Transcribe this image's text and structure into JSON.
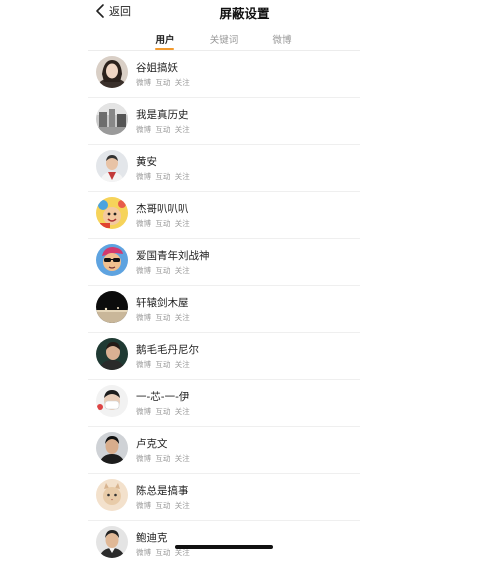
{
  "navbar": {
    "back_label": "返回",
    "title": "屏蔽设置"
  },
  "tabs": [
    {
      "label": "用户",
      "active": true
    },
    {
      "label": "关键词",
      "active": false
    },
    {
      "label": "微博",
      "active": false
    }
  ],
  "accent_color": "#f29a2e",
  "meta_labels": {
    "weibo": "微博",
    "interact": "互动",
    "follow": "关注"
  },
  "users": [
    {
      "name": "谷姐搞妖",
      "avatar_icon": "woman-portrait-icon"
    },
    {
      "name": "我是真历史",
      "avatar_icon": "vintage-photo-icon"
    },
    {
      "name": "黄安",
      "avatar_icon": "man-portrait-icon"
    },
    {
      "name": "杰哥叭叭叭",
      "avatar_icon": "cartoon-face-icon"
    },
    {
      "name": "爱国青年刘战神",
      "avatar_icon": "cartoon-sunglasses-icon"
    },
    {
      "name": "轩辕剑木屋",
      "avatar_icon": "dark-scene-icon"
    },
    {
      "name": "鹅毛毛丹尼尔",
      "avatar_icon": "man-portrait-icon"
    },
    {
      "name": "一-芯-一-伊",
      "avatar_icon": "masked-face-icon"
    },
    {
      "name": "卢克文",
      "avatar_icon": "man-portrait-icon"
    },
    {
      "name": "陈总是搞事",
      "avatar_icon": "cat-icon"
    },
    {
      "name": "鲍迪克",
      "avatar_icon": "man-portrait-icon"
    }
  ]
}
